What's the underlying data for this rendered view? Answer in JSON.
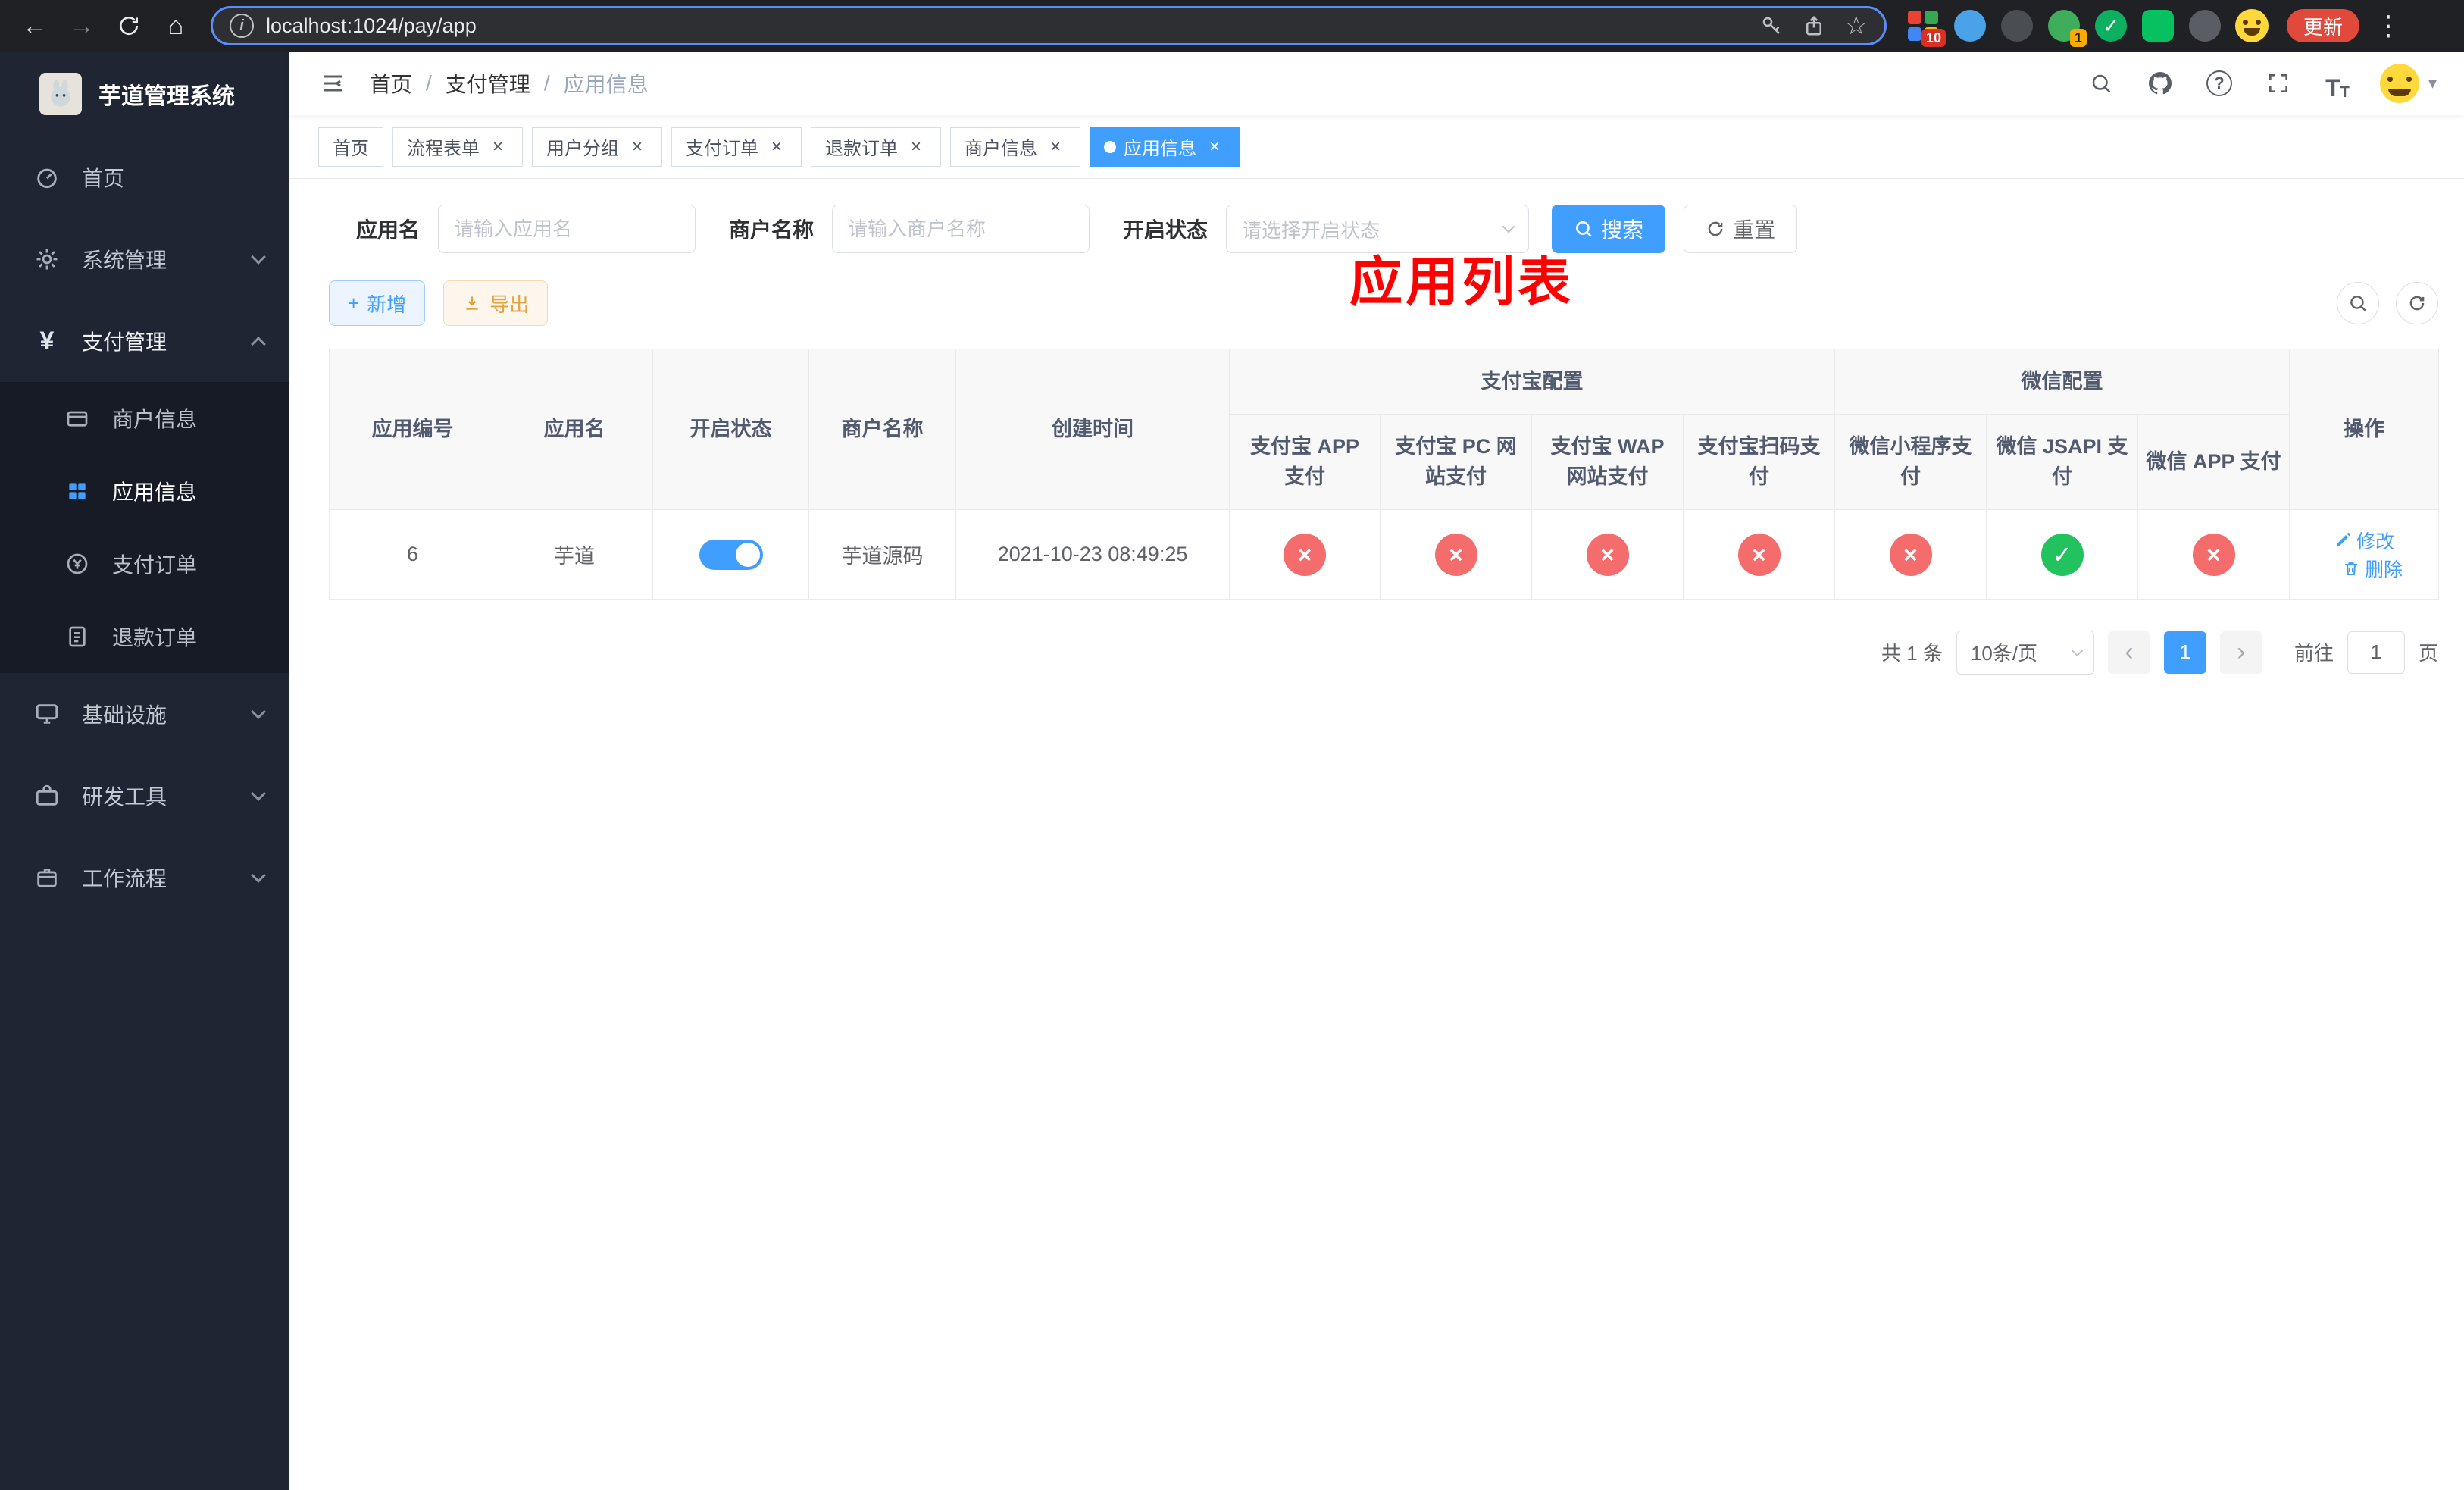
{
  "colors": {
    "primary": "#409eff",
    "success": "#22c35e",
    "error": "#f56c6c",
    "warning": "#e6a23c",
    "overlay": "#ff0000"
  },
  "browser": {
    "url": "localhost:1024/pay/app",
    "update_label": "更新",
    "extensions_badge": "10",
    "avatar_badge": "1"
  },
  "sidebar": {
    "title": "芋道管理系统",
    "items": {
      "home": "首页",
      "system": "系统管理",
      "payment": "支付管理",
      "infra": "基础设施",
      "devtools": "研发工具",
      "workflow": "工作流程"
    },
    "payment_children": {
      "merchant": "商户信息",
      "app": "应用信息",
      "order": "支付订单",
      "refund": "退款订单"
    }
  },
  "breadcrumb": {
    "home": "首页",
    "section": "支付管理",
    "current": "应用信息",
    "separator": "/"
  },
  "overlay_title": "应用列表",
  "tabs": [
    {
      "label": "首页"
    },
    {
      "label": "流程表单"
    },
    {
      "label": "用户分组"
    },
    {
      "label": "支付订单"
    },
    {
      "label": "退款订单"
    },
    {
      "label": "商户信息"
    },
    {
      "label": "应用信息"
    }
  ],
  "filters": {
    "app_name_label": "应用名",
    "app_name_placeholder": "请输入应用名",
    "merchant_label": "商户名称",
    "merchant_placeholder": "请输入商户名称",
    "status_label": "开启状态",
    "status_placeholder": "请选择开启状态",
    "search_label": "搜索",
    "reset_label": "重置"
  },
  "toolbar": {
    "add_label": "新增",
    "export_label": "导出"
  },
  "table": {
    "columns": {
      "id": "应用编号",
      "name": "应用名",
      "status": "开启状态",
      "merchant": "商户名称",
      "created": "创建时间",
      "actions": "操作"
    },
    "alipay": {
      "label": "支付宝配置",
      "cols": [
        "支付宝 APP 支付",
        "支付宝 PC 网站支付",
        "支付宝 WAP 网站支付",
        "支付宝扫码支付"
      ]
    },
    "wechat": {
      "label": "微信配置",
      "cols": [
        "微信小程序支付",
        "微信 JSAPI 支付",
        "微信 APP 支付"
      ]
    },
    "rows": [
      {
        "id": "6",
        "name": "芋道",
        "enabled": true,
        "merchant": "芋道源码",
        "created": "2021-10-23 08:49:25",
        "configs": [
          "error",
          "error",
          "error",
          "error",
          "error",
          "success",
          "error"
        ],
        "edit_label": "修改",
        "delete_label": "删除"
      }
    ]
  },
  "pagination": {
    "total": "共 1 条",
    "page_size": "10条/页",
    "current_page": "1",
    "goto_label": "前往",
    "goto_value": "1",
    "goto_unit": "页"
  }
}
